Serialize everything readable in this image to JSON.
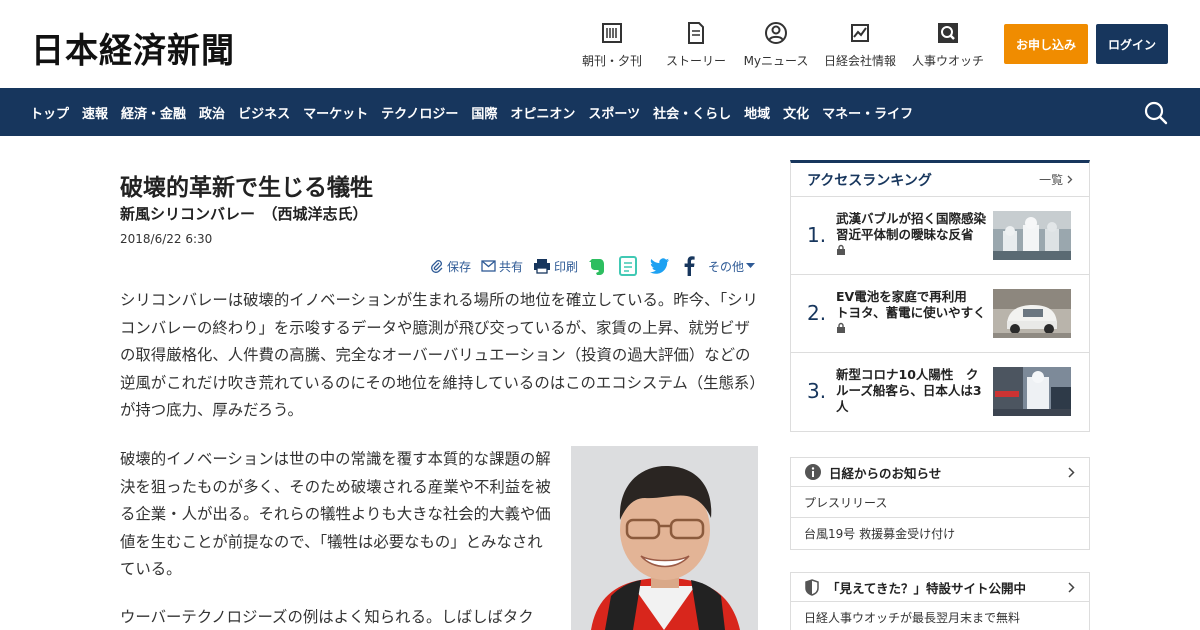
{
  "site": {
    "logo": "日本経済新聞"
  },
  "header_nav": [
    {
      "label": "朝刊・夕刊",
      "icon": "newspaper-icon"
    },
    {
      "label": "ストーリー",
      "icon": "story-icon"
    },
    {
      "label": "Myニュース",
      "icon": "user-icon"
    },
    {
      "label": "日経会社情報",
      "icon": "company-chart-icon"
    },
    {
      "label": "人事ウオッチ",
      "icon": "personnel-search-icon"
    }
  ],
  "buttons": {
    "apply": "お申し込み",
    "login": "ログイン"
  },
  "nav": [
    "トップ",
    "速報",
    "経済・金融",
    "政治",
    "ビジネス",
    "マーケット",
    "テクノロジー",
    "国際",
    "オピニオン",
    "スポーツ",
    "社会・くらし",
    "地域",
    "文化",
    "マネー・ライフ"
  ],
  "article": {
    "title": "破壊的革新で生じる犠牲",
    "subtitle": "新風シリコンバレー　（西城洋志氏）",
    "date": "2018/6/22 6:30",
    "share": {
      "save": "保存",
      "share": "共有",
      "print": "印刷",
      "more": "その他"
    },
    "p1": "シリコンバレーは破壊的イノベーションが生まれる場所の地位を確立している。昨今、「シリコンバレーの終わり」を示唆するデータや臆測が飛び交っているが、家賃の上昇、就労ビザの取得厳格化、人件費の高騰、完全なオーバーバリュエーション（投資の過大評価）などの逆風がこれだけ吹き荒れているのにその地位を維持しているのはこのエコシステム（生態系）が持つ底力、厚みだろう。",
    "p2": "破壊的イノベーションは世の中の常識を覆す本質的な課題の解決を狙ったものが多く、そのため破壊される産業や不利益を被る企業・人が出る。それらの犠牲よりも大きな社会的大義や価値を生むことが前提なので、「犠牲は必要なもの」とみなされている。",
    "p3": "ウーバーテクノロジーズの例はよく知られる。しばしばタク"
  },
  "ranking": {
    "title": "アクセスランキング",
    "more": "一覧",
    "items": [
      {
        "rank": "1.",
        "text": "武漢バブルが招く国際感染　習近平体制の曖昧な反省"
      },
      {
        "rank": "2.",
        "text": "EV電池を家庭で再利用　トヨタ、蓄電に使いやすく"
      },
      {
        "rank": "3.",
        "text": "新型コロナ10人陽性　クルーズ船客ら、日本人は3人"
      }
    ]
  },
  "notice1": {
    "title": "日経からのお知らせ",
    "rows": [
      "プレスリリース",
      "台風19号 救援募金受け付け"
    ]
  },
  "notice2": {
    "title": "「見えてきた？」特設サイト公開中",
    "rows": [
      "日経人事ウオッチが最長翌月末まで無料"
    ]
  },
  "colors": {
    "navy": "#17365d",
    "orange": "#f08c00"
  }
}
